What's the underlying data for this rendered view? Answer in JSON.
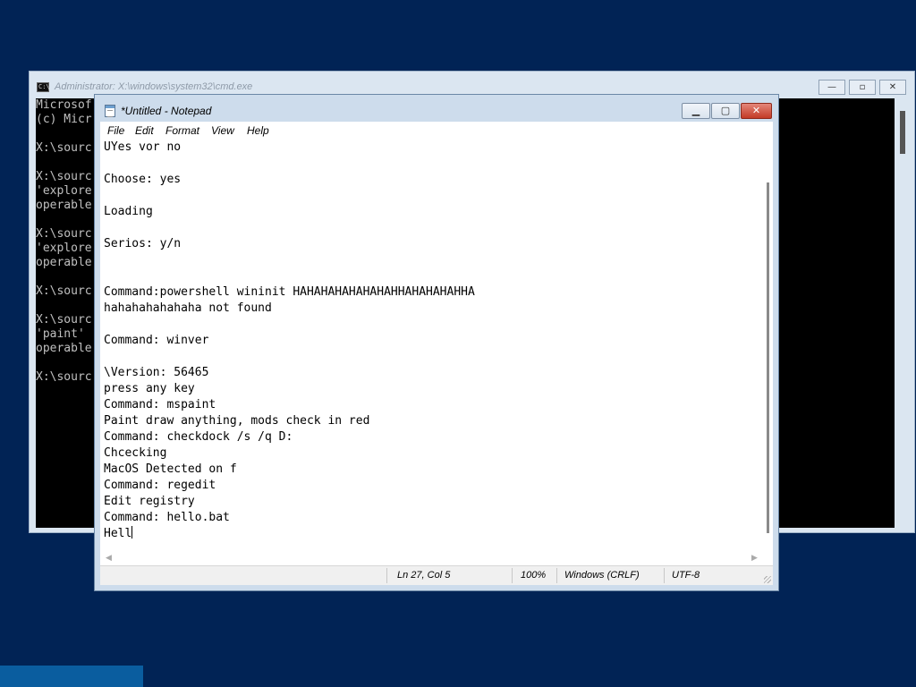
{
  "cmd": {
    "title": "Administrator: X:\\windows\\system32\\cmd.exe",
    "icon": "cmd-icon",
    "lines": [
      "Microsof",
      "(c) Micr",
      "",
      "X:\\sourc",
      "",
      "X:\\sourc",
      "'explore",
      "operable",
      "",
      "X:\\sourc",
      "'explore",
      "operable",
      "",
      "X:\\sourc",
      "",
      "X:\\sourc",
      "'paint'",
      "operable",
      "",
      "X:\\sourc"
    ]
  },
  "notepad": {
    "title": "*Untitled - Notepad",
    "icon": "notepad-icon",
    "menu": [
      "File",
      "Edit",
      "Format",
      "View",
      "Help"
    ],
    "lines": [
      "UYes vor no",
      "",
      "Choose: yes",
      "",
      "Loading",
      "",
      "Serios: y/n",
      "",
      "",
      "Command:powershell wininit HAHAHAHAHAHAHAHHAHAHAHAHHA",
      "hahahahahahaha not found",
      "",
      "Command: winver",
      "",
      "\\Version: 56465",
      "press any key",
      "Command: mspaint",
      "Paint draw anything, mods check in red",
      "Command: checkdock /s /q D:",
      "Chcecking",
      "MacOS Detected on f",
      "Command: regedit",
      "Edit registry",
      "Command: hello.bat",
      "Hell"
    ],
    "status": {
      "position": "Ln 27, Col 5",
      "zoom": "100%",
      "line_ending": "Windows (CRLF)",
      "encoding": "UTF-8"
    }
  },
  "colors": {
    "desktop": "#012355",
    "console_bg": "#000000",
    "console_text": "#c0c0c0",
    "close_button": "#c33b26"
  }
}
